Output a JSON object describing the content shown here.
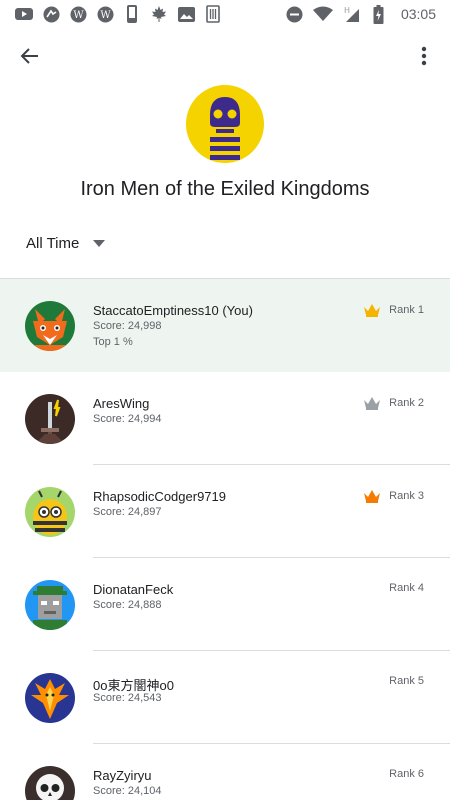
{
  "status_bar": {
    "time": "03:05",
    "icons": [
      "youtube-icon",
      "app-circle-icon",
      "wp-icon",
      "wp-icon",
      "phone-icon",
      "maple-leaf-icon",
      "image-icon",
      "trash-icon",
      "dnd-icon",
      "wifi-icon",
      "h-signal-icon",
      "battery-charging-icon"
    ]
  },
  "app_bar": {
    "back_icon": "arrow-back-icon",
    "more_icon": "more-vert-icon"
  },
  "leaderboard": {
    "title": "Iron Men of the Exiled Kingdoms",
    "icon": "skull-icon",
    "colors": {
      "icon_bg": "#F5D300",
      "icon_fg": "#3D2A8C"
    }
  },
  "filter": {
    "label": "All Time",
    "icon": "dropdown-arrow-icon"
  },
  "colors": {
    "highlight_row": "#EEF5F1",
    "crown_gold": "#F5B400",
    "crown_silver": "#9AA0A6",
    "crown_bronze": "#F57C00"
  },
  "players": [
    {
      "name": "StaccatoEmptiness10 (You)",
      "score": "Score: 24,998",
      "extra": "Top 1 %",
      "rank": "Rank 1",
      "crown": "gold",
      "avatar": "fox-avatar"
    },
    {
      "name": "AresWing",
      "score": "Score: 24,994",
      "rank": "Rank 2",
      "crown": "silver",
      "avatar": "sword-avatar"
    },
    {
      "name": "RhapsodicCodger9719",
      "score": "Score: 24,897",
      "rank": "Rank 3",
      "crown": "bronze",
      "avatar": "bee-avatar"
    },
    {
      "name": "DionatanFeck",
      "score": "Score: 24,888",
      "rank": "Rank 4",
      "avatar": "robot-avatar"
    },
    {
      "name": "0o東方闇神o0",
      "score": "Score: 24,543",
      "rank": "Rank 5",
      "avatar": "phoenix-avatar"
    },
    {
      "name": "RayZyiryu",
      "score": "Score: 24,104",
      "rank": "Rank 6",
      "avatar": "skull-avatar"
    }
  ]
}
